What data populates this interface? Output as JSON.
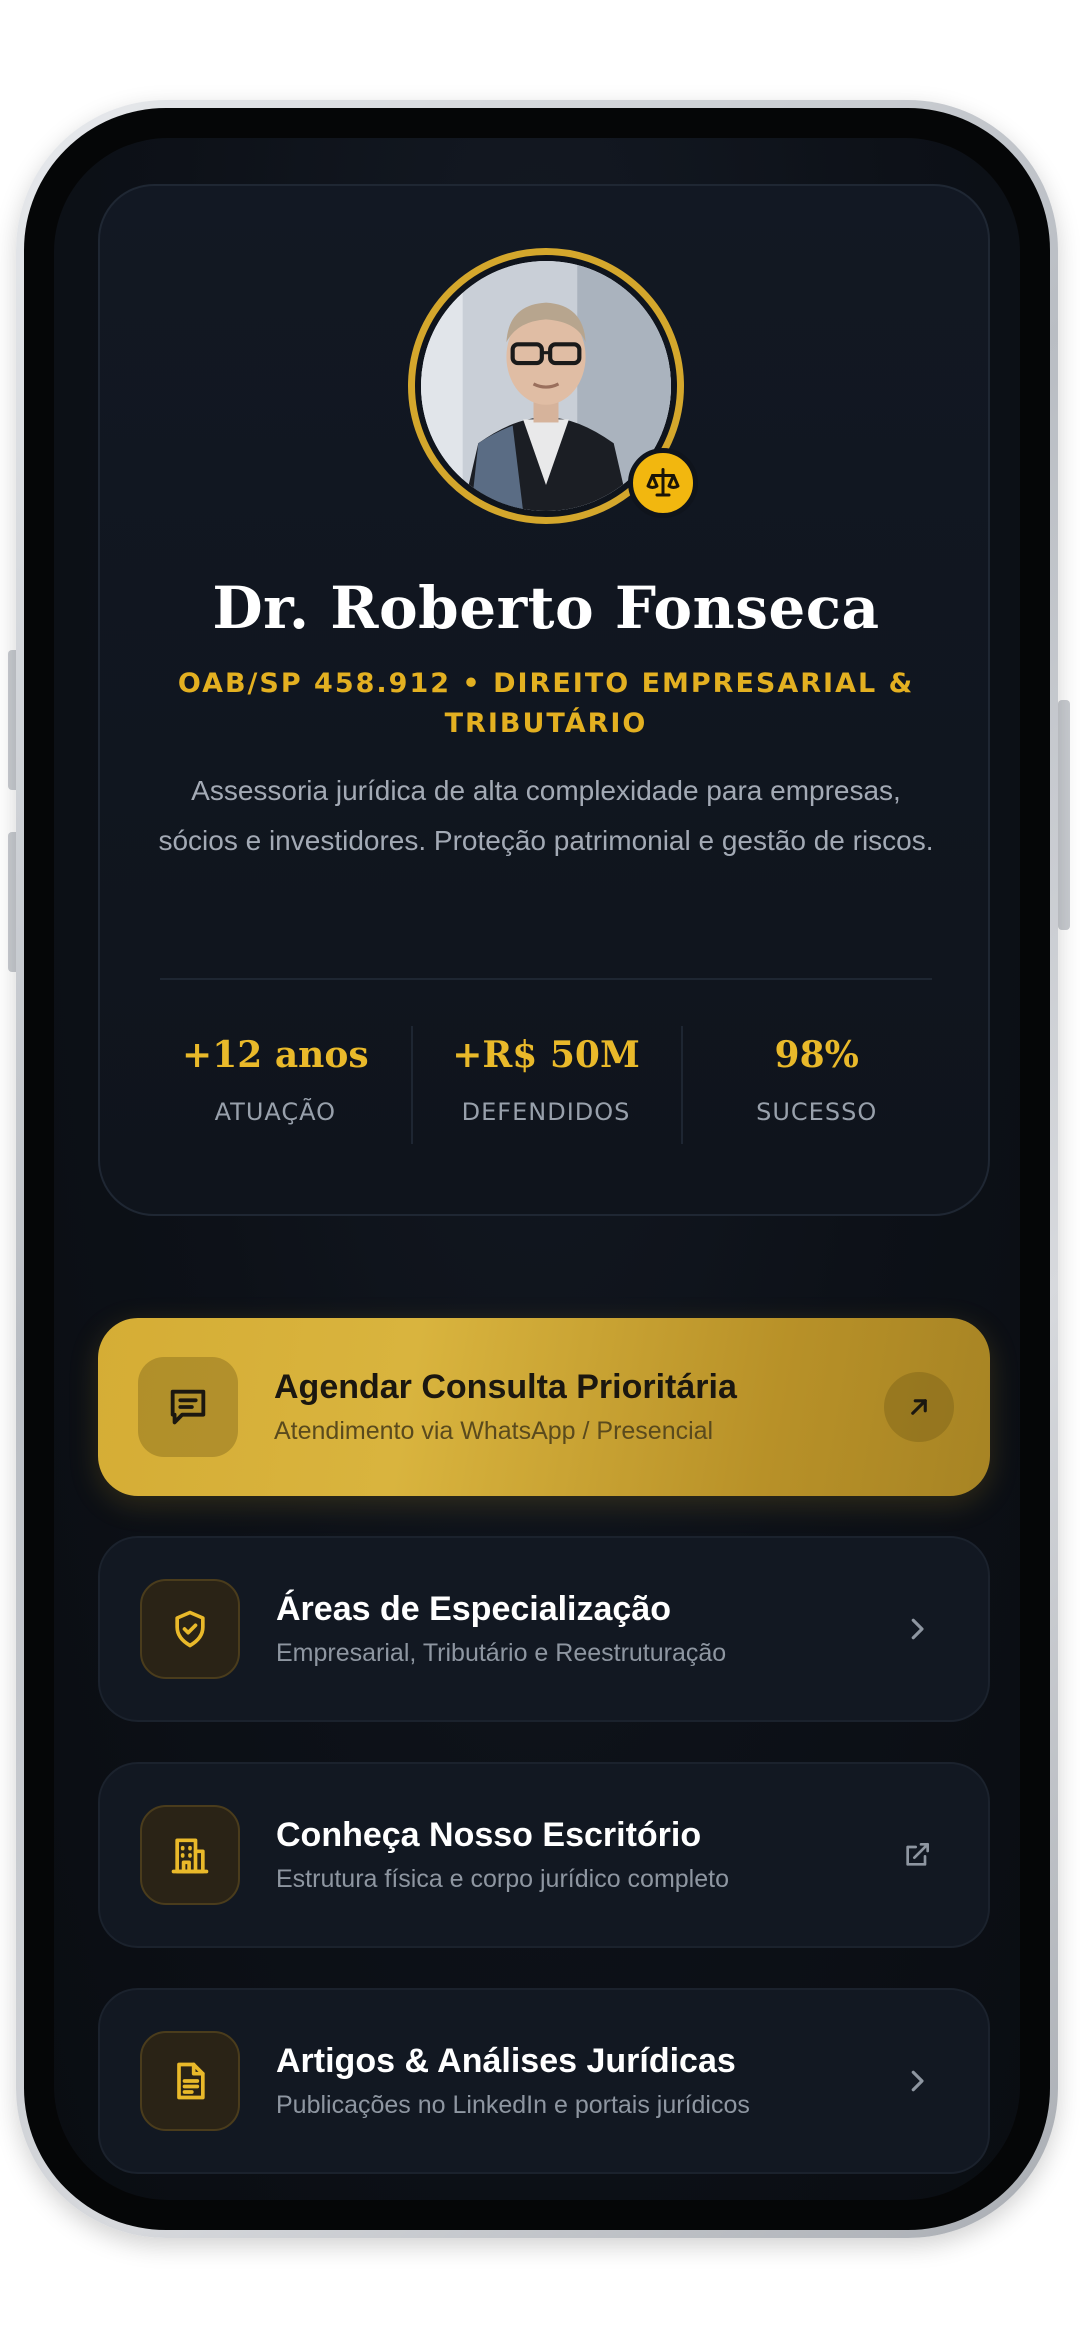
{
  "profile": {
    "name": "Dr. Roberto Fonseca",
    "credential": "OAB/SP 458.912 • DIREITO EMPRESARIAL & TRIBUTÁRIO",
    "bio": "Assessoria jurídica de alta complexidade para empresas, sócios e investidores. Proteção patrimonial e gestão de riscos.",
    "avatar_icon": "portrait-photo",
    "badge_icon": "scale-icon"
  },
  "stats": [
    {
      "value": "+12 anos",
      "label": "ATUAÇÃO"
    },
    {
      "value": "+R$ 50M",
      "label": "DEFENDIDOS"
    },
    {
      "value": "98%",
      "label": "SUCESSO"
    }
  ],
  "links": [
    {
      "title": "Agendar Consulta Prioritária",
      "subtitle": "Atendimento via WhatsApp / Presencial",
      "icon": "chat-message-icon",
      "trail_icon": "arrow-up-right-icon"
    },
    {
      "title": "Áreas de Especialização",
      "subtitle": "Empresarial, Tributário e Reestruturação",
      "icon": "shield-check-icon",
      "trail_icon": "chevron-right-icon"
    },
    {
      "title": "Conheça Nosso Escritório",
      "subtitle": "Estrutura física e corpo jurídico completo",
      "icon": "building-icon",
      "trail_icon": "external-link-icon"
    },
    {
      "title": "Artigos & Análises Jurídicas",
      "subtitle": "Publicações no LinkedIn e portais jurídicos",
      "icon": "document-icon",
      "trail_icon": "chevron-right-icon"
    }
  ],
  "colors": {
    "accent_gold": "#e3b021",
    "background": "#0d1118",
    "card": "#121822"
  }
}
